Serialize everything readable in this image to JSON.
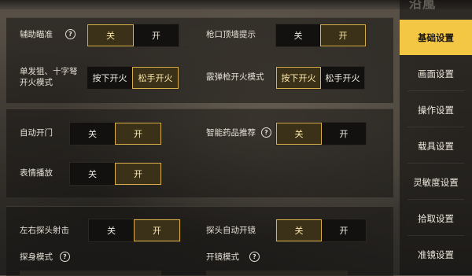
{
  "screen_title": "沿嵐",
  "sidebar": {
    "items": [
      {
        "label": "基础设置",
        "active": true
      },
      {
        "label": "画面设置",
        "active": false
      },
      {
        "label": "操作设置",
        "active": false
      },
      {
        "label": "载具设置",
        "active": false
      },
      {
        "label": "灵敏度设置",
        "active": false
      },
      {
        "label": "拾取设置",
        "active": false
      },
      {
        "label": "准镜设置",
        "active": false
      }
    ]
  },
  "settings": {
    "aim_assist": {
      "label": "辅助瞄准",
      "off": "关",
      "on": "开",
      "selected": "off"
    },
    "muzzle_wall_hint": {
      "label": "枪口顶墙提示",
      "off": "关",
      "on": "开",
      "selected": "on"
    },
    "single_fire_mode": {
      "label": "单发狙、十字弩开火模式",
      "press": "按下开火",
      "release": "松手开火",
      "selected": "release"
    },
    "shotgun_fire_mode": {
      "label": "霰弹枪开火模式",
      "press": "按下开火",
      "release": "松手开火",
      "selected": "press"
    },
    "auto_open_door": {
      "label": "自动开门",
      "off": "关",
      "on": "开",
      "selected": "on"
    },
    "smart_medicine": {
      "label": "智能药品推荐",
      "off": "关",
      "on": "开",
      "selected": "off"
    },
    "emote_play": {
      "label": "表情播放",
      "off": "关",
      "on": "开",
      "selected": "on"
    },
    "peek_fire": {
      "label": "左右探头射击",
      "off": "关",
      "on": "开",
      "selected": "on"
    },
    "peek_auto_scope": {
      "label": "探头自动开镜",
      "off": "关",
      "on": "开",
      "selected": "off"
    },
    "peek_mode": {
      "label": "探身模式"
    },
    "scope_mode": {
      "label": "开镜模式"
    }
  },
  "icons": {
    "help": "question-circle-icon"
  },
  "colors": {
    "accent": "#f3c744",
    "selected_border": "#d9b04a"
  }
}
